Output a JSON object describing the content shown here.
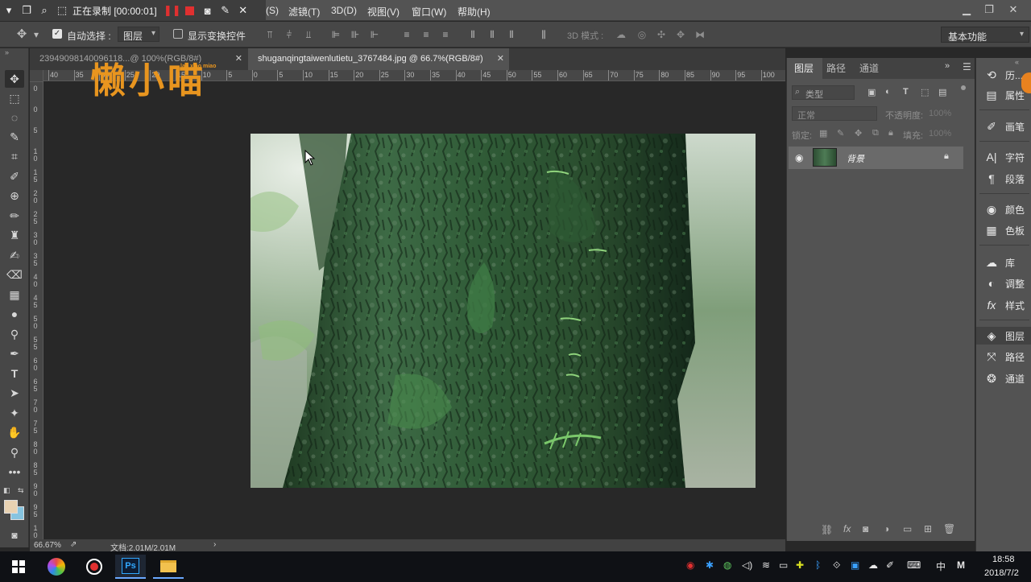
{
  "recording": {
    "status_text": "正在录制 [00:00:01]"
  },
  "menu": {
    "items": [
      "(S)",
      "滤镜(T)",
      "3D(D)",
      "视图(V)",
      "窗口(W)",
      "帮助(H)"
    ]
  },
  "options_bar": {
    "auto_select_label": "自动选择 :",
    "auto_select_value": "图层",
    "show_transform_label": "显示变换控件",
    "mode_3d_label": "3D 模式 :",
    "workspace": "基本功能"
  },
  "tabs": [
    {
      "label": "23949098140096118...@ 100%(RGB/8#)",
      "active": false
    },
    {
      "label": "shuganqingtaiwenlutietu_3767484.jpg @ 66.7%(RGB/8#)",
      "active": true
    }
  ],
  "ruler": {
    "h_ticks": [
      "40",
      "35",
      "30",
      "25",
      "20",
      "15",
      "10",
      "5",
      "0",
      "5",
      "10",
      "15",
      "20",
      "25",
      "30",
      "35",
      "40",
      "45",
      "50",
      "55",
      "60",
      "65",
      "70",
      "75",
      "80",
      "85",
      "90",
      "95",
      "100"
    ],
    "v_ticks": [
      "0",
      "0",
      "5",
      "1 0",
      "1 5",
      "2 0",
      "2 5",
      "3 0",
      "3 5",
      "4 0",
      "4 5",
      "5 0",
      "5 5",
      "6 0",
      "6 5",
      "7 0",
      "7 5",
      "8 0",
      "8 5",
      "9 0",
      "9 5",
      "1 0 0"
    ]
  },
  "status": {
    "zoom": "66.67%",
    "doc_info": "文档:2.01M/2.01M"
  },
  "layers_panel": {
    "tabs": [
      "图层",
      "路径",
      "通道"
    ],
    "filter_placeholder": "类型",
    "blend_mode": "正常",
    "opacity_label": "不透明度:",
    "opacity_value": "100%",
    "lock_label": "锁定:",
    "fill_label": "填充:",
    "fill_value": "100%",
    "layer_name": "背景"
  },
  "dock": {
    "items": [
      "历...",
      "属性",
      "画笔",
      "字符",
      "段落",
      "颜色",
      "色板",
      "库",
      "调整",
      "样式",
      "图层",
      "路径",
      "通道"
    ]
  },
  "watermark": {
    "main": "懒小喵",
    "sub": "lan xiao miao"
  },
  "taskbar": {
    "time": "18:58",
    "date": "2018/7/2",
    "ime": "中",
    "ime2": "M",
    "ps_label": "Ps"
  },
  "colors": {
    "accent_orange": "#e8951f",
    "rec_red": "#e03030",
    "menubar": "#535353",
    "panel": "#535353",
    "canvas_bg": "#282828"
  }
}
